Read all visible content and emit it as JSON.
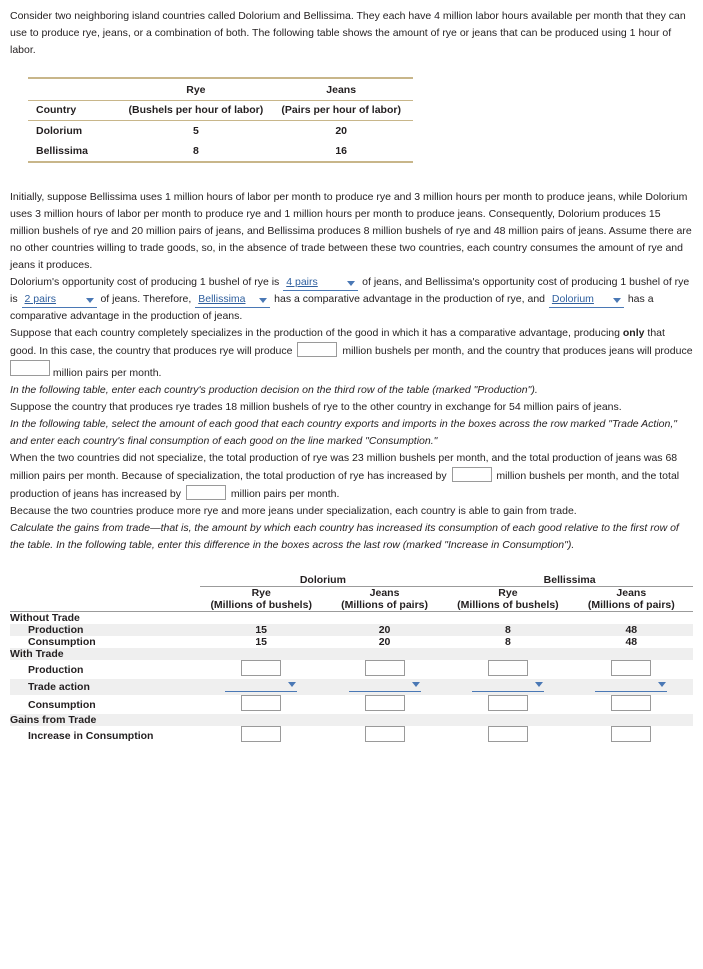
{
  "intro": {
    "p1": "Consider two neighboring island countries called Dolorium and Bellissima. They each have 4 million labor hours available per month that they can use to produce rye, jeans, or a combination of both. The following table shows the amount of rye or jeans that can be produced using 1 hour of labor."
  },
  "top_table": {
    "headers": {
      "country": "Country",
      "rye": "Rye",
      "jeans": "Jeans",
      "rye_sub": "(Bushels per hour of labor)",
      "jeans_sub": "(Pairs per hour of labor)"
    },
    "rows": [
      {
        "country": "Dolorium",
        "rye": "5",
        "jeans": "20"
      },
      {
        "country": "Bellissima",
        "rye": "8",
        "jeans": "16"
      }
    ]
  },
  "body": {
    "p2": "Initially, suppose Bellissima uses 1 million hours of labor per month to produce rye and 3 million hours per month to produce jeans, while Dolorium uses 3 million hours of labor per month to produce rye and 1 million hours per month to produce jeans. Consequently, Dolorium produces 15 million bushels of rye and 20 million pairs of jeans, and Bellissima produces 8 million bushels of rye and 48 million pairs of jeans. Assume there are no other countries willing to trade goods, so, in the absence of trade between these two countries, each country consumes the amount of rye and jeans it produces.",
    "p3a": "Dolorium's opportunity cost of producing 1 bushel of rye is",
    "p3_dd1": "4 pairs",
    "p3b": "of jeans, and Bellissima's opportunity cost of producing 1 bushel of rye is",
    "p3_dd2": "2 pairs",
    "p3c": "of jeans. Therefore,",
    "p3_dd3": "Bellissima",
    "p3d": "has a comparative advantage in the production of rye, and",
    "p3_dd4": "Dolorium",
    "p3e": "has a comparative advantage in the production of jeans.",
    "p4a": "Suppose that each country completely specializes in the production of the good in which it has a comparative advantage, producing",
    "p4_only": "only",
    "p4b": "that good. In this case, the country that produces rye will produce",
    "p4c": "million bushels per month, and the country that produces jeans will produce",
    "p4d": "million pairs per month.",
    "p5": "In the following table, enter each country's production decision on the third row of the table (marked \"Production\").",
    "p6": "Suppose the country that produces rye trades 18 million bushels of rye to the other country in exchange for 54 million pairs of jeans.",
    "p7": "In the following table, select the amount of each good that each country exports and imports in the boxes across the row marked \"Trade Action,\" and enter each country's final consumption of each good on the line marked \"Consumption.\"",
    "p8a": "When the two countries did not specialize, the total production of rye was 23 million bushels per month, and the total production of jeans was 68 million pairs per month. Because of specialization, the total production of rye has increased by",
    "p8b": "million bushels per month, and the total production of jeans has increased by",
    "p8c": "million pairs per month.",
    "p9": "Because the two countries produce more rye and more jeans under specialization, each country is able to gain from trade.",
    "p10": "Calculate the gains from trade—that is, the amount by which each country has increased its consumption of each good relative to the first row of the table. In the following table, enter this difference in the boxes across the last row (marked \"Increase in Consumption\")."
  },
  "bottom_table": {
    "group_headers": [
      "Dolorium",
      "Bellissima"
    ],
    "col_headers": [
      "Rye",
      "Jeans",
      "Rye",
      "Jeans"
    ],
    "col_subheaders": [
      "(Millions of bushels)",
      "(Millions of pairs)",
      "(Millions of bushels)",
      "(Millions of pairs)"
    ],
    "rows": [
      {
        "label": "Without Trade",
        "type": "section",
        "shaded": false,
        "cells": []
      },
      {
        "label": "Production",
        "type": "values",
        "shaded": true,
        "cells": [
          "15",
          "20",
          "8",
          "48"
        ]
      },
      {
        "label": "Consumption",
        "type": "values",
        "shaded": false,
        "cells": [
          "15",
          "20",
          "8",
          "48"
        ]
      },
      {
        "label": "With Trade",
        "type": "section",
        "shaded": true,
        "cells": []
      },
      {
        "label": "Production",
        "type": "inputs",
        "shaded": false,
        "cells": [
          "",
          "",
          "",
          ""
        ]
      },
      {
        "label": "Trade action",
        "type": "dropdowns",
        "shaded": true,
        "cells": [
          "",
          "",
          "",
          ""
        ]
      },
      {
        "label": "Consumption",
        "type": "inputs",
        "shaded": false,
        "cells": [
          "",
          "",
          "",
          ""
        ]
      },
      {
        "label": "Gains from Trade",
        "type": "section",
        "shaded": true,
        "cells": []
      },
      {
        "label": "Increase in Consumption",
        "type": "inputs",
        "shaded": false,
        "cells": [
          "",
          "",
          "",
          ""
        ]
      }
    ]
  },
  "colors": {
    "link": "#2f5f9e",
    "table_rule": "#c8b68a",
    "row_shade": "#efefef"
  }
}
